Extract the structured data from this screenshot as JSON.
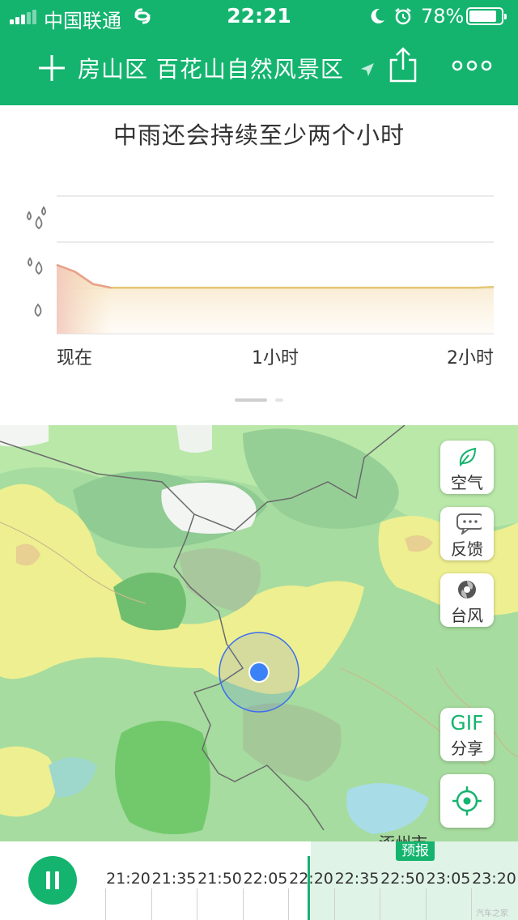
{
  "status_bar": {
    "carrier": "中国联通",
    "time": "22:21",
    "battery": "78%",
    "battery_level": 0.78
  },
  "nav": {
    "location": "房山区 百花山自然风景区",
    "icons": [
      "plus-icon",
      "location-arrow-icon",
      "share-icon",
      "more-icon"
    ]
  },
  "forecast": {
    "headline": "中雨还会持续至少两个小时",
    "x_labels": [
      "现在",
      "1小时",
      "2小时"
    ],
    "intensity_icons": [
      "heavy-rain-drops-icon",
      "moderate-rain-drops-icon",
      "light-rain-drop-icon"
    ]
  },
  "chart_data": {
    "type": "area",
    "x": [
      0,
      5,
      10,
      15,
      20,
      30,
      45,
      60,
      75,
      90,
      105,
      115,
      120
    ],
    "values": [
      1.5,
      1.35,
      1.08,
      1.0,
      1.0,
      1.0,
      1.0,
      1.0,
      1.0,
      1.0,
      1.0,
      1.0,
      1.02
    ],
    "ylim": [
      0,
      3
    ],
    "grid": true
  },
  "map_controls": [
    {
      "label": "空气",
      "icon": "leaf-icon"
    },
    {
      "label": "反馈",
      "icon": "feedback-bubble-icon"
    },
    {
      "label": "台风",
      "icon": "typhoon-icon"
    }
  ],
  "gif_share": {
    "title": "GIF",
    "label": "分享"
  },
  "locate_button": {
    "icon": "locate-target-icon"
  },
  "map_text": {
    "city_label": "涿州市"
  },
  "timeline": {
    "forecast_badge": "预报",
    "times": [
      "21:20",
      "21:35",
      "21:50",
      "22:05",
      "22:20",
      "22:35",
      "22:50",
      "23:05",
      "23:20"
    ],
    "watermark": "汽车之家"
  },
  "colors": {
    "brand_green": "#14b46f",
    "rain_line": "#e4c774",
    "heavy_rain_line": "#e8a08a"
  }
}
